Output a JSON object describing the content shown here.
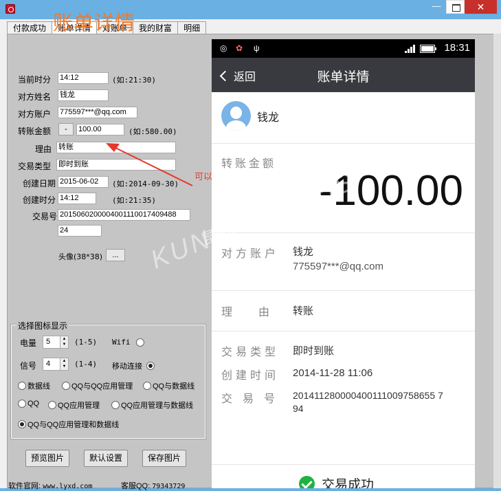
{
  "window": {
    "minimize": "—",
    "close": "✕"
  },
  "tabs": [
    "付款成功",
    "账单详情",
    "对账单",
    "我的财富",
    "明细"
  ],
  "form": {
    "title": "账单详情",
    "fields": {
      "time_label": "当前时分",
      "time_value": "14:12",
      "time_hint": "(如:21:30)",
      "name_label": "对方姓名",
      "name_value": "钱龙",
      "account_label": "对方账户",
      "account_value": "775597***@qq.com",
      "amount_label": "转账金额",
      "amount_sign": "-",
      "amount_value": "100.00",
      "amount_hint": "(如:580.00)",
      "reason_label": "理由",
      "reason_value": "转账",
      "type_label": "交易类型",
      "type_value": "即时到账",
      "date_label": "创建日期",
      "date_value": "2015-06-02",
      "date_hint": "(如:2014-09-30)",
      "ctime_label": "创建时分",
      "ctime_value": "14:12",
      "ctime_hint": "(如:21:35)",
      "txn_label": "交易号",
      "txn_value": "2015060200004001110017409488",
      "txn_value2": "24"
    },
    "avatar_label": "头像(38*38)",
    "avatar_btn": "..."
  },
  "icon_group": {
    "title": "选择图标显示",
    "battery_label": "电量",
    "battery_value": "5",
    "battery_range": "(1-5)",
    "wifi_label": "Wifi",
    "signal_label": "信号",
    "signal_value": "4",
    "signal_range": "(1-4)",
    "mobile_label": "移动连接",
    "options": [
      "数据线",
      "QQ与QQ应用管理",
      "QQ与数据线",
      "QQ",
      "QQ应用管理",
      "QQ应用管理与数据线",
      "QQ与QQ应用管理和数据线"
    ],
    "selected": "QQ与QQ应用管理和数据线"
  },
  "actions": {
    "preview": "预览图片",
    "default": "默认设置",
    "save": "保存图片"
  },
  "footer": {
    "site_label": "软件官网:",
    "site": "www.lyxd.com",
    "qq_label": "客服QQ:",
    "qq": "79343729"
  },
  "annotation": "可以修改的",
  "watermark": "KUNSHAN BBS",
  "watermark_cn": "昆山论坛",
  "phone": {
    "time": "18:31",
    "back": "返回",
    "title": "账单详情",
    "name": "钱龙",
    "amount_label": "转账金额",
    "amount": "-100.00",
    "account_label": "对方账户",
    "account_name": "钱龙",
    "account_email": "775597***@qq.com",
    "reason_label": "理由",
    "reason": "转账",
    "type_label": "交易类型",
    "type": "即时到账",
    "created_label": "创建时间",
    "created": "2014-11-28 11:06",
    "txn_label": "交易号",
    "txn": "20141128000040011100975865579 4",
    "txn_line1": "201411280000400111009758655 7",
    "txn_line2": "94",
    "status": "交易成功"
  },
  "colors": {
    "accent": "#f07a2a",
    "navbar": "#393a3f",
    "success": "#20b241",
    "annotation": "#e8362b"
  }
}
